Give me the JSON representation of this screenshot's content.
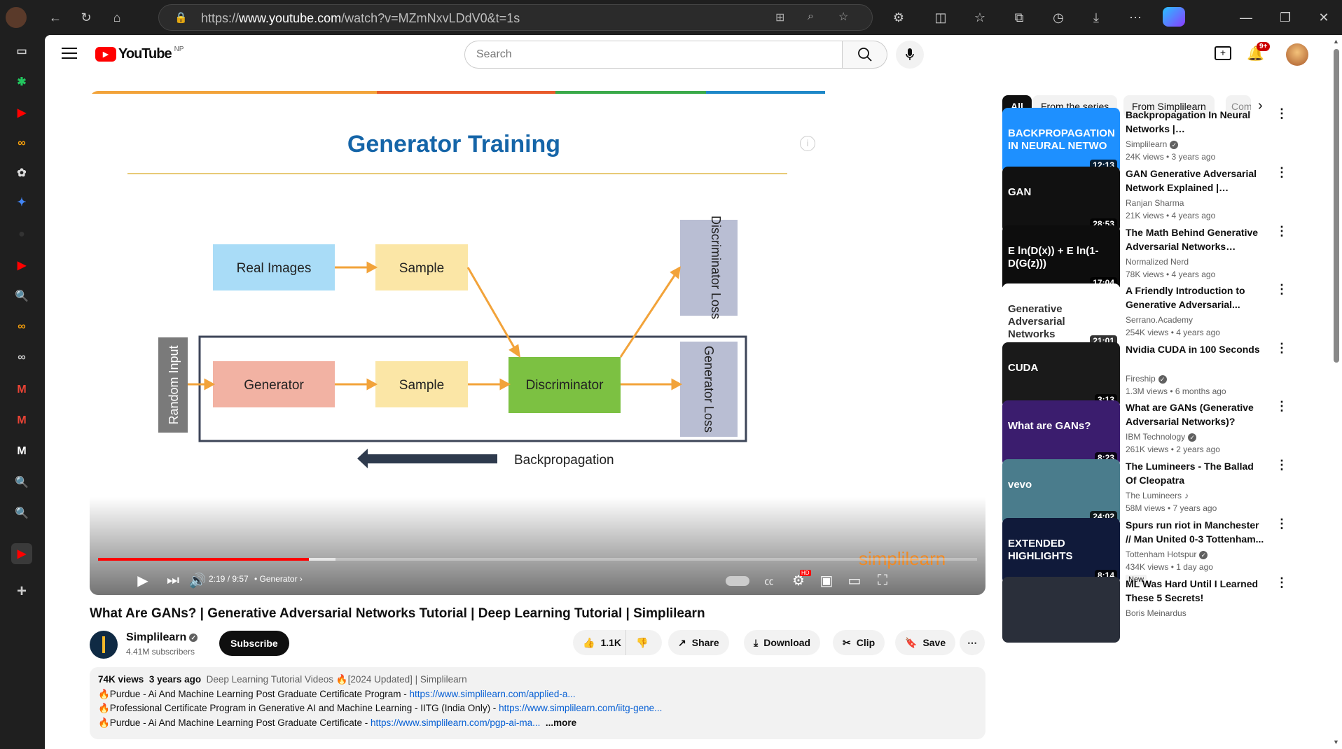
{
  "browser": {
    "url_prefix": "https://",
    "url_host": "www.youtube.com",
    "url_path": "/watch?v=MZmNxvLDdV0&t=1s"
  },
  "sidebar": {
    "items": [
      {
        "icon": "tabs-icon",
        "color": "#ccc",
        "glyph": "▭"
      },
      {
        "icon": "app-green-icon",
        "color": "#22c55e",
        "glyph": "✱"
      },
      {
        "icon": "youtube-icon",
        "color": "#ff0000",
        "glyph": "▶"
      },
      {
        "icon": "coursera-icon",
        "color": "#f59e0b",
        "glyph": "∞"
      },
      {
        "icon": "chatgpt-icon",
        "color": "#ddd",
        "glyph": "✿"
      },
      {
        "icon": "gemini-icon",
        "color": "#4285f4",
        "glyph": "✦"
      },
      {
        "icon": "github-icon",
        "color": "#333",
        "glyph": "●"
      },
      {
        "icon": "youtube-icon",
        "color": "#ff0000",
        "glyph": "▶"
      },
      {
        "icon": "search-icon",
        "color": "#ddd",
        "glyph": "🔍"
      },
      {
        "icon": "coursera-icon",
        "color": "#f59e0b",
        "glyph": "∞"
      },
      {
        "icon": "infinity-icon",
        "color": "#ccc",
        "glyph": "∞"
      },
      {
        "icon": "gmail-icon",
        "color": "#ea4335",
        "glyph": "M"
      },
      {
        "icon": "gmail-icon",
        "color": "#ea4335",
        "glyph": "M"
      },
      {
        "icon": "medium-icon",
        "color": "#fff",
        "glyph": "M"
      },
      {
        "icon": "search-icon",
        "color": "#ddd",
        "glyph": "🔍"
      },
      {
        "icon": "search-icon",
        "color": "#ddd",
        "glyph": "🔍"
      },
      {
        "icon": "youtube-icon",
        "color": "#ff0000",
        "glyph": "▶"
      },
      {
        "icon": "add-icon",
        "color": "#ccc",
        "glyph": "+"
      }
    ]
  },
  "youtube": {
    "logo_text": "YouTube",
    "region": "NP",
    "search_placeholder": "Search",
    "notification_count": "9+"
  },
  "player": {
    "slide_title": "Generator Training",
    "nodes": {
      "real_images": "Real Images",
      "sample_top": "Sample",
      "generator": "Generator",
      "sample_bottom": "Sample",
      "discriminator": "Discriminator",
      "discriminator_loss": "Discriminator Loss",
      "generator_loss": "Generator Loss",
      "random_input": "Random Input",
      "backprop": "Backpropagation"
    },
    "watermark": "simplilearn",
    "time": "2:19 / 9:57",
    "chapter": "Generator",
    "progress_fraction": 0.24,
    "buffered_fraction": 0.27,
    "hd_badge": "HD"
  },
  "video": {
    "title": "What Are GANs? | Generative Adversarial Networks Tutorial | Deep Learning Tutorial | Simplilearn",
    "channel": "Simplilearn",
    "subscribers": "4.41M subscribers",
    "subscribe_label": "Subscribe",
    "likes": "1.1K",
    "share_label": "Share",
    "download_label": "Download",
    "clip_label": "Clip",
    "save_label": "Save"
  },
  "description": {
    "views": "74K views",
    "age": "3 years ago",
    "tags": "Deep Learning Tutorial Videos",
    "updated": "🔥[2024 Updated] | Simplilearn",
    "lines": [
      {
        "text": "🔥Purdue - Ai And Machine Learning Post Graduate Certificate Program  - ",
        "link": "https://www.simplilearn.com/applied-a..."
      },
      {
        "text": "🔥Professional Certificate Program in Generative AI and Machine Learning - IITG (India Only)  - ",
        "link": "https://www.simplilearn.com/iitg-gene..."
      },
      {
        "text": "🔥Purdue - Ai And Machine Learning Post Graduate Certificate  - ",
        "link": "https://www.simplilearn.com/pgp-ai-ma..."
      }
    ],
    "more_label": "...more"
  },
  "chips": [
    "All",
    "From the series",
    "From Simplilearn",
    "Com"
  ],
  "recommendations": [
    {
      "title": "Backpropagation In Neural Networks | Backpropagation...",
      "channel": "Simplilearn",
      "verified": true,
      "meta": "24K views  • 3 years ago",
      "duration": "12:13",
      "thumb_bg": "#1e90ff",
      "thumb_text": "BACKPROPAGATION IN NEURAL NETWO"
    },
    {
      "title": "GAN Generative Adversarial Network Explained | Generativ...",
      "channel": "Ranjan Sharma",
      "verified": false,
      "meta": "21K views  • 4 years ago",
      "duration": "28:53",
      "thumb_bg": "#111",
      "thumb_text": "GAN"
    },
    {
      "title": "The Math Behind Generative Adversarial Networks Clearly...",
      "channel": "Normalized Nerd",
      "verified": false,
      "meta": "78K views  • 4 years ago",
      "duration": "17:04",
      "thumb_bg": "#0d0d0d",
      "thumb_text": "E ln(D(x)) + E ln(1-D(G(z)))"
    },
    {
      "title": "A Friendly Introduction to Generative Adversarial...",
      "channel": "Serrano.Academy",
      "verified": false,
      "meta": "254K views  • 4 years ago",
      "duration": "21:01",
      "thumb_bg": "#ffffff",
      "thumb_text": "Generative Adversarial Networks"
    },
    {
      "title": "Nvidia CUDA in 100 Seconds",
      "channel": "Fireship",
      "verified": true,
      "meta": "1.3M views  • 6 months ago",
      "duration": "3:13",
      "thumb_bg": "#1a1a1a",
      "thumb_text": "CUDA"
    },
    {
      "title": "What are GANs (Generative Adversarial Networks)?",
      "channel": "IBM Technology",
      "verified": true,
      "meta": "261K views  • 2 years ago",
      "duration": "8:23",
      "thumb_bg": "#3b1d6e",
      "thumb_text": "What are GANs?"
    },
    {
      "title": "The Lumineers - The Ballad Of Cleopatra",
      "channel": "The Lumineers",
      "verified": false,
      "music": true,
      "meta": "58M views  • 7 years ago",
      "duration": "24:02",
      "thumb_bg": "#4a7c8c",
      "thumb_text": "vevo"
    },
    {
      "title": "Spurs run riot in Manchester // Man United 0-3 Tottenham...",
      "channel": "Tottenham Hotspur",
      "verified": true,
      "meta": "434K views  • 1 day ago",
      "badge": "New",
      "duration": "8:14",
      "thumb_bg": "#101a3a",
      "thumb_text": "EXTENDED HIGHLIGHTS"
    },
    {
      "title": "ML Was Hard Until I Learned These 5 Secrets!",
      "channel": "Boris Meinardus",
      "verified": false,
      "meta": "",
      "duration": "",
      "thumb_bg": "#2a2f3a",
      "thumb_text": ""
    }
  ]
}
